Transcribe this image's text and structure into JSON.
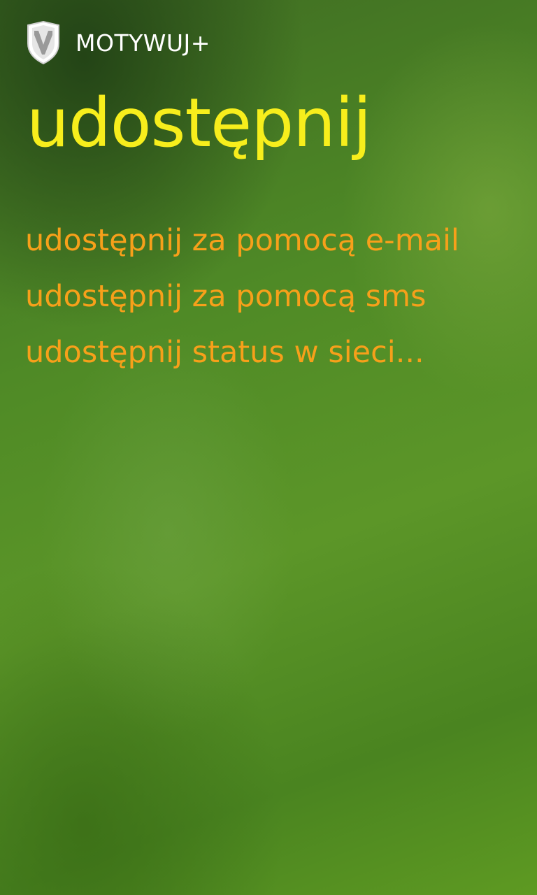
{
  "header": {
    "app_title": "MOTYWUJ+",
    "logo_icon": "shield-logo-icon"
  },
  "page": {
    "title": "udostępnij"
  },
  "menu": {
    "items": [
      {
        "label": "udostępnij za pomocą e-mail"
      },
      {
        "label": "udostępnij za pomocą sms"
      },
      {
        "label": "udostępnij status w sieci..."
      }
    ]
  },
  "colors": {
    "title": "#f7ee1c",
    "menu_item": "#f7a01a",
    "app_title": "#ffffff"
  }
}
